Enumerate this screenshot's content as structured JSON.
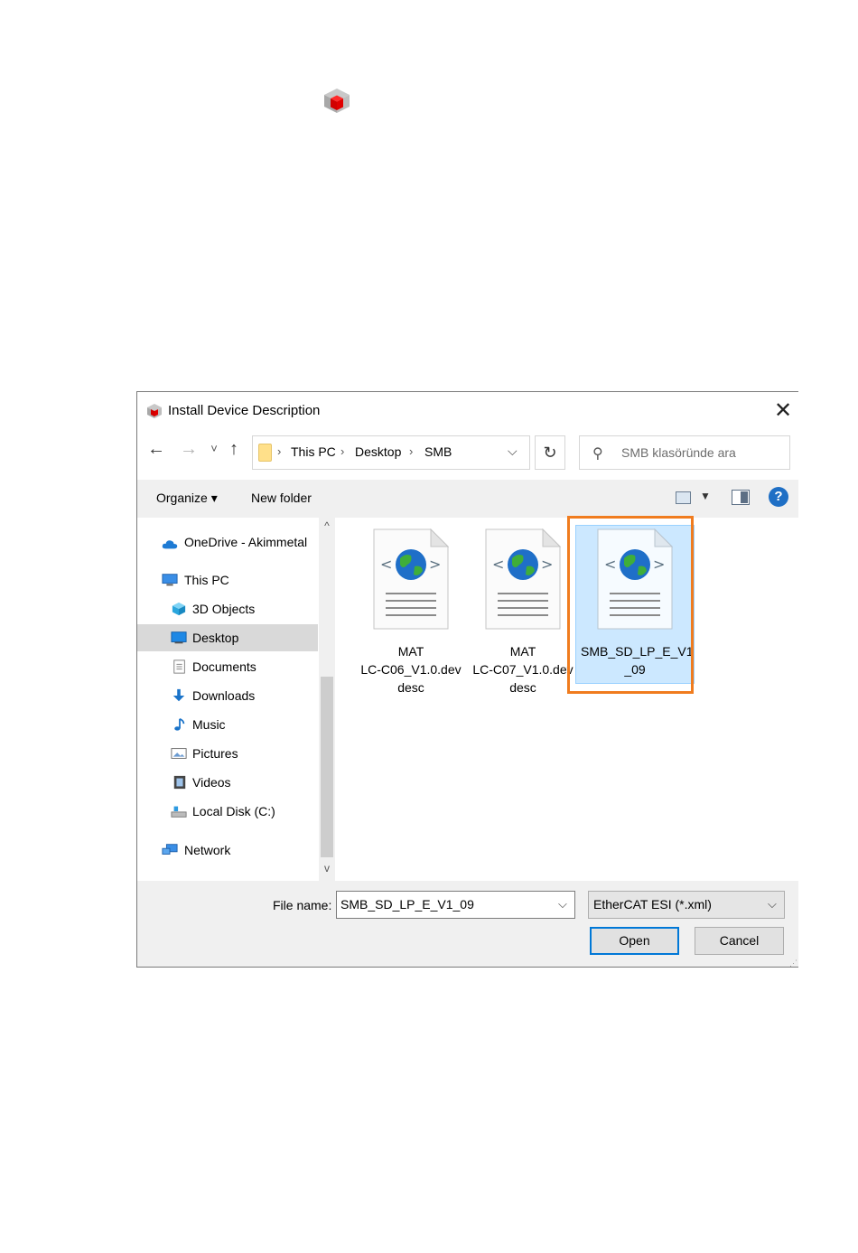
{
  "dialog": {
    "title": "Install Device Description",
    "close_glyph": "✕"
  },
  "nav": {
    "back_glyph": "←",
    "forward_glyph": "→",
    "recent_glyph": "˅",
    "up_glyph": "↑",
    "breadcrumb": [
      "This PC",
      "Desktop",
      "SMB"
    ],
    "crumb_sep": "›",
    "address_dropdown_glyph": "⌵",
    "refresh_glyph": "↻",
    "search_icon_glyph": "⚲",
    "search_placeholder": "SMB klasöründe ara"
  },
  "toolbar": {
    "organize": "Organize ▾",
    "new_folder": "New folder",
    "view_dropdown": "▼",
    "help": "?"
  },
  "sidebar": {
    "items": [
      {
        "label": "OneDrive - Akimmetal",
        "icon": "cloud-icon"
      },
      {
        "label": "This PC",
        "icon": "computer-icon"
      },
      {
        "label": "3D Objects",
        "icon": "cube-icon"
      },
      {
        "label": "Desktop",
        "icon": "desktop-icon",
        "selected": true
      },
      {
        "label": "Documents",
        "icon": "documents-icon"
      },
      {
        "label": "Downloads",
        "icon": "download-icon"
      },
      {
        "label": "Music",
        "icon": "music-icon"
      },
      {
        "label": "Pictures",
        "icon": "pictures-icon"
      },
      {
        "label": "Videos",
        "icon": "videos-icon"
      },
      {
        "label": "Local Disk (C:)",
        "icon": "disk-icon"
      },
      {
        "label": "Network",
        "icon": "network-icon"
      }
    ],
    "scroll_up": "^",
    "scroll_down": "v"
  },
  "files": [
    {
      "line1": "MAT",
      "line2": "LC-C06_V1.0.dev",
      "line3": "desc",
      "icon": "xml-globe-file-icon"
    },
    {
      "line1": "MAT",
      "line2": "LC-C07_V1.0.dev",
      "line3": "desc",
      "icon": "xml-globe-file-icon"
    },
    {
      "line1": "SMB_SD_LP_E_V1",
      "line2": "_09",
      "line3": "",
      "icon": "xml-globe-file-icon",
      "selected": true
    }
  ],
  "footer": {
    "file_name_label": "File name:",
    "file_name_value": "SMB_SD_LP_E_V1_09",
    "file_type_value": "EtherCAT ESI (*.xml)",
    "dropdown_glyph": "⌵",
    "open_label": "Open",
    "cancel_label": "Cancel"
  },
  "colors": {
    "highlight_outline": "#f07c1f",
    "selection_fill": "#cce8ff",
    "primary_button_border": "#0078d7"
  }
}
